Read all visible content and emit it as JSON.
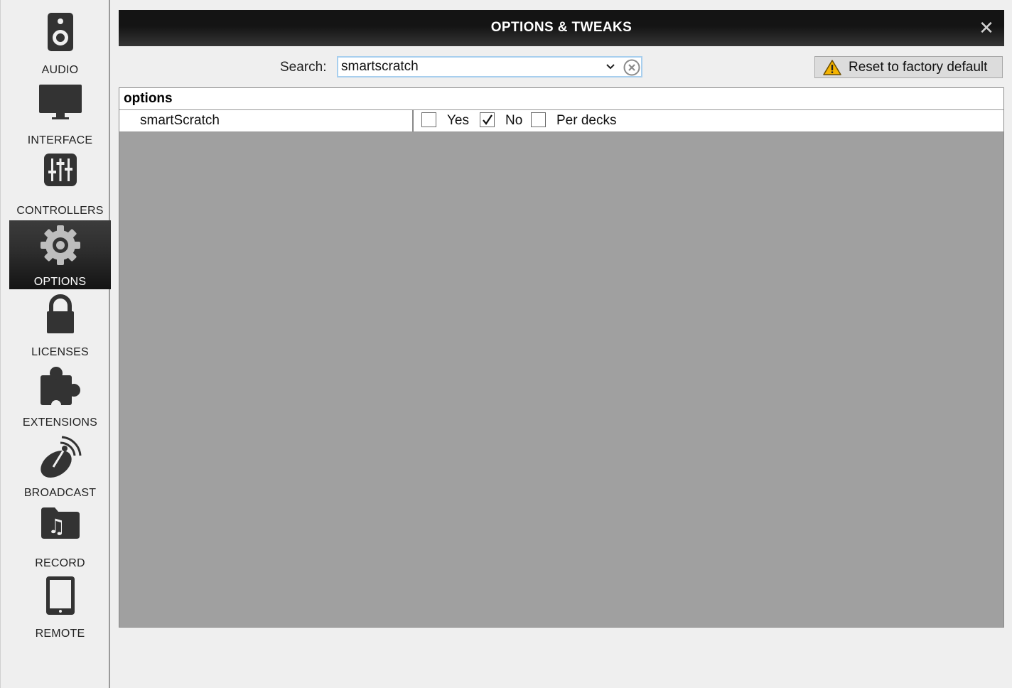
{
  "sidebar": {
    "items": [
      {
        "label": "AUDIO",
        "icon": "speaker-icon"
      },
      {
        "label": "INTERFACE",
        "icon": "monitor-icon"
      },
      {
        "label": "CONTROLLERS",
        "icon": "mixer-sliders-icon"
      },
      {
        "label": "OPTIONS",
        "icon": "gear-icon",
        "active": true
      },
      {
        "label": "LICENSES",
        "icon": "lock-icon"
      },
      {
        "label": "EXTENSIONS",
        "icon": "puzzle-icon"
      },
      {
        "label": "BROADCAST",
        "icon": "satellite-dish-icon"
      },
      {
        "label": "RECORD",
        "icon": "music-folder-icon"
      },
      {
        "label": "REMOTE",
        "icon": "tablet-icon"
      }
    ]
  },
  "dialog": {
    "title": "OPTIONS & TWEAKS",
    "close_glyph": "✕"
  },
  "search": {
    "label": "Search:",
    "value": "smartscratch"
  },
  "reset": {
    "label": "Reset to factory default"
  },
  "table": {
    "header": "options",
    "rows": [
      {
        "name": "smartScratch",
        "choices": [
          {
            "label": "Yes",
            "checked": false
          },
          {
            "label": "No",
            "checked": true
          },
          {
            "label": "Per decks",
            "checked": false
          }
        ]
      }
    ]
  },
  "colors": {
    "active_nav_bg": "#2d2d2d",
    "header_bg": "#141414",
    "table_empty_bg": "#a0a0a0",
    "search_border": "#a8cfee",
    "warning_yellow": "#f5b400"
  }
}
